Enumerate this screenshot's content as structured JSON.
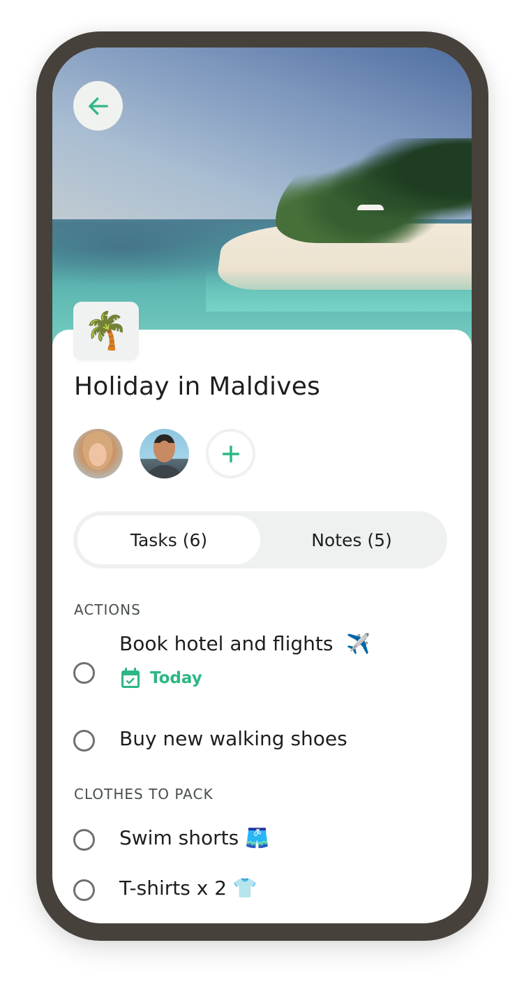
{
  "header": {
    "back_icon": "arrow-left-icon",
    "hero_image_alt": "Tropical beach with palm trees and turquoise water"
  },
  "project": {
    "emoji": "🌴",
    "emoji_name": "palm-tree",
    "title": "Holiday in Maldives"
  },
  "members": {
    "avatars": [
      {
        "name": "member-avatar-woman"
      },
      {
        "name": "member-avatar-man"
      }
    ],
    "add_icon": "plus-icon"
  },
  "tabs": [
    {
      "label": "Tasks (6)",
      "active": true
    },
    {
      "label": "Notes (5)",
      "active": false
    }
  ],
  "sections": [
    {
      "label": "ACTIONS",
      "tasks": [
        {
          "text": "Book hotel and flights",
          "emoji": "✈️",
          "due": "Today",
          "completed": false
        },
        {
          "text": "Buy new walking shoes",
          "emoji": "",
          "completed": false
        }
      ]
    },
    {
      "label": "CLOTHES TO PACK",
      "tasks": [
        {
          "text": "Swim shorts",
          "emoji": "🩳",
          "completed": false
        },
        {
          "text": "T-shirts x 2",
          "emoji": "👕",
          "completed": false
        }
      ]
    }
  ],
  "colors": {
    "accent": "#2db783",
    "frame": "#46413b",
    "segment_bg": "#eff1f0",
    "text": "#1c1f1e",
    "muted": "#474e4b"
  }
}
